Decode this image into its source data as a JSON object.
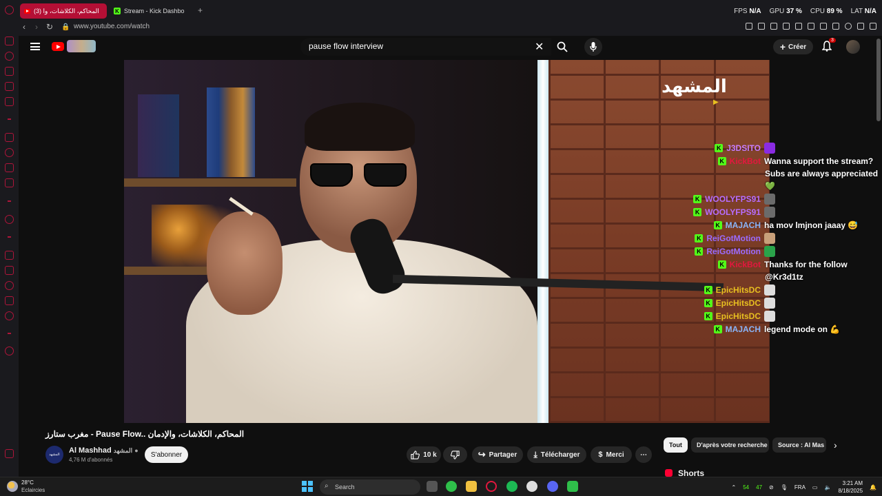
{
  "browser": {
    "tabs": [
      {
        "label": "(3) المحاكم، الكلاشات، وا",
        "active": true
      },
      {
        "label": "Stream - Kick Dashbo",
        "active": false
      }
    ],
    "new_tab_label": "+",
    "url": "www.youtube.com/watch",
    "perf": {
      "fps_label": "FPS",
      "fps_value": "N/A",
      "gpu_label": "GPU",
      "gpu_value": "37 %",
      "cpu_label": "CPU",
      "cpu_value": "89 %",
      "lat_label": "LAT",
      "lat_value": "N/A"
    }
  },
  "youtube": {
    "search_value": "pause flow interview",
    "create_label": "Créer",
    "notification_count": "3",
    "video_overlay_logo": "المشهد",
    "video_title": "مغرب ستارز - Pause Flow.. المحاكم، الكلاشات، والإدمان",
    "channel": {
      "name": "Al Mashhad",
      "name_ar": "المشهد",
      "subscribers": "4,76 M d'abonnés",
      "avatar_text": "المشهد"
    },
    "subscribe_label": "S'abonner",
    "actions": {
      "likes": "10 k",
      "share": "Partager",
      "download": "Télécharger",
      "thanks": "Merci",
      "more": "⋯"
    },
    "chips": [
      "Tout",
      "D'après votre recherche",
      "Source : Al Mas"
    ],
    "shorts_label": "Shorts"
  },
  "chat": [
    {
      "user": "J3DSITO",
      "color": "#c77dff",
      "message": "",
      "emote": "#8a2be2"
    },
    {
      "user": "KickBot",
      "color": "#e3173e",
      "message": "Wanna support the stream?",
      "emote": ""
    },
    {
      "user": "",
      "color": "#fff",
      "message": "Subs are always appreciated",
      "emote": ""
    },
    {
      "user": "",
      "color": "#fff",
      "message": "💚",
      "emote": ""
    },
    {
      "user": "WOOLYFPS91",
      "color": "#b66dff",
      "message": "",
      "emote": "#6b6b6b"
    },
    {
      "user": "WOOLYFPS91",
      "color": "#b66dff",
      "message": "",
      "emote": "#6b6b6b"
    },
    {
      "user": "MAJACH",
      "color": "#8ab4f8",
      "message": "ha mov lmjnon jaaay 😅",
      "emote": ""
    },
    {
      "user": "ReiGotMotion",
      "color": "#9b6bff",
      "message": "",
      "emote": "#c8a07a"
    },
    {
      "user": "ReiGotMotion",
      "color": "#9b6bff",
      "message": "",
      "emote": "#2aa34a"
    },
    {
      "user": "KickBot",
      "color": "#e3173e",
      "message": "Thanks for the follow",
      "emote": ""
    },
    {
      "user": "",
      "color": "#fff",
      "message": "@Kr3d1tz",
      "emote": ""
    },
    {
      "user": "EpicHitsDC",
      "color": "#e8c020",
      "message": "",
      "emote": "#ddd"
    },
    {
      "user": "EpicHitsDC",
      "color": "#e8c020",
      "message": "",
      "emote": "#ddd"
    },
    {
      "user": "EpicHitsDC",
      "color": "#e8c020",
      "message": "",
      "emote": "#ddd"
    },
    {
      "user": "MAJACH",
      "color": "#8ab4f8",
      "message": "legend mode on 💪",
      "emote": ""
    }
  ],
  "taskbar": {
    "weather_temp": "28°C",
    "weather_cond": "Eclaircies",
    "search_label": "Search",
    "tray_num1": "54",
    "tray_num2": "47",
    "lang": "FRA",
    "time": "3:21 AM",
    "date": "8/18/2025"
  }
}
